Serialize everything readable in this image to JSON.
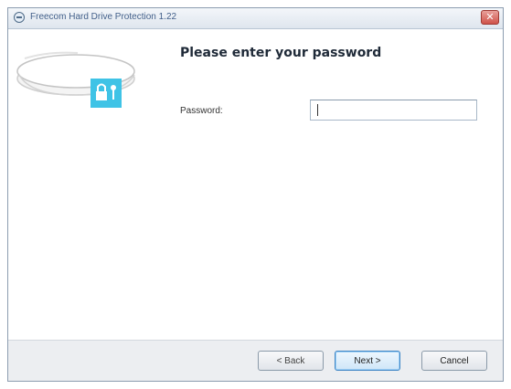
{
  "window": {
    "title": "Freecom Hard Drive Protection 1.22",
    "close_symbol": "✕"
  },
  "icons": {
    "app": "app-icon",
    "illustration": "hard-drive-lock-icon"
  },
  "colors": {
    "accent": "#3fc3e6",
    "button_focus": "#3f86c6"
  },
  "main": {
    "heading": "Please enter your password",
    "password_label": "Password:",
    "password_value": ""
  },
  "footer": {
    "back_label": "< Back",
    "next_label": "Next >",
    "cancel_label": "Cancel"
  }
}
